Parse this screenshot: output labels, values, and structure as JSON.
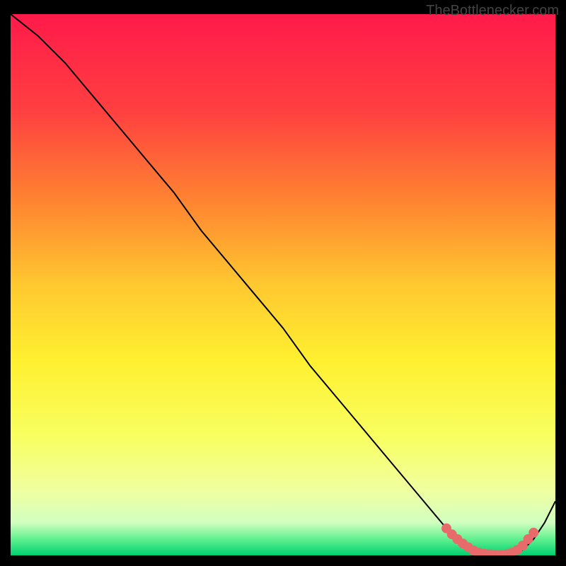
{
  "watermark": "TheBottlenecker.com",
  "chart_data": {
    "type": "line",
    "title": "",
    "xlabel": "",
    "ylabel": "",
    "xlim": [
      0,
      100
    ],
    "ylim": [
      0,
      100
    ],
    "grid": false,
    "x": [
      0,
      5,
      10,
      15,
      20,
      25,
      30,
      35,
      40,
      45,
      50,
      55,
      60,
      65,
      70,
      75,
      80,
      82,
      84,
      86,
      88,
      90,
      92,
      94,
      96,
      98,
      100
    ],
    "y": [
      100,
      96,
      91,
      85,
      79,
      73,
      67,
      60,
      54,
      48,
      42,
      35,
      29,
      23,
      17,
      11,
      5,
      3,
      1.5,
      0.5,
      0.2,
      0.1,
      0.2,
      1,
      3,
      6,
      10
    ],
    "markers": {
      "x": [
        80,
        81,
        82,
        83,
        84,
        85,
        86,
        87,
        88,
        89,
        90,
        91,
        92,
        93,
        94,
        95,
        96
      ],
      "y": [
        5,
        3.9,
        3,
        2.2,
        1.5,
        0.9,
        0.5,
        0.3,
        0.2,
        0.1,
        0.1,
        0.2,
        0.5,
        1,
        1.8,
        3,
        4.2
      ],
      "color": "#e86b6b"
    }
  },
  "background": {
    "stops": [
      {
        "offset": 0.0,
        "color": "#ff1a4a"
      },
      {
        "offset": 0.18,
        "color": "#ff4040"
      },
      {
        "offset": 0.36,
        "color": "#ff8a30"
      },
      {
        "offset": 0.5,
        "color": "#ffc830"
      },
      {
        "offset": 0.64,
        "color": "#fff030"
      },
      {
        "offset": 0.78,
        "color": "#f8ff60"
      },
      {
        "offset": 0.88,
        "color": "#f0ffa0"
      },
      {
        "offset": 0.94,
        "color": "#d0ffc0"
      },
      {
        "offset": 0.97,
        "color": "#60f090"
      },
      {
        "offset": 1.0,
        "color": "#00d070"
      }
    ]
  }
}
